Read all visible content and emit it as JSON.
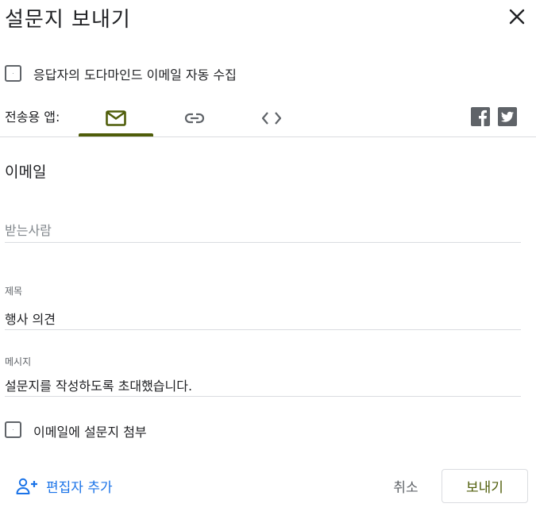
{
  "dialog": {
    "title": "설문지 보내기",
    "close_icon": "close-icon"
  },
  "collect_email": {
    "label": "응답자의 도다마인드 이메일 자동 수집",
    "checked": false
  },
  "send_via": {
    "label": "전송용 앱:",
    "tabs": [
      {
        "icon": "mail-icon",
        "selected": true
      },
      {
        "icon": "link-icon",
        "selected": false
      },
      {
        "icon": "embed-code-icon",
        "selected": false
      }
    ],
    "social": [
      {
        "icon": "facebook-icon"
      },
      {
        "icon": "twitter-icon"
      }
    ],
    "accent_color": "#4f5d09"
  },
  "email": {
    "heading": "이메일",
    "recipients_placeholder": "받는사람",
    "recipients_value": "",
    "subject_label": "제목",
    "subject_value": "행사 의견",
    "message_label": "메시지",
    "message_value": "설문지를 작성하도록 초대했습니다.",
    "attach_label": "이메일에 설문지 첨부",
    "attach_checked": false
  },
  "footer": {
    "add_editor_label": "편집자 추가",
    "add_editor_color": "#1a73e8",
    "cancel_label": "취소",
    "send_label": "보내기"
  }
}
